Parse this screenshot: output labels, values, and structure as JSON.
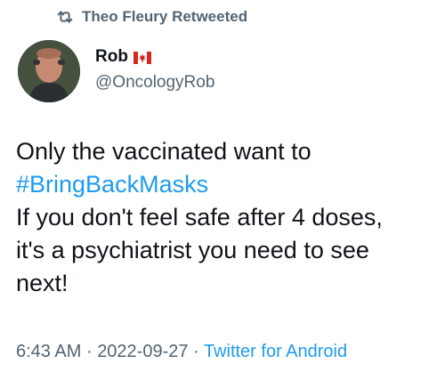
{
  "retweet": {
    "icon": "retweet-icon",
    "text": "Theo Fleury Retweeted"
  },
  "author": {
    "display_name": "Rob",
    "flag_icon": "canada-flag-icon",
    "handle": "@OncologyRob"
  },
  "tweet": {
    "lines": [
      "Only the vaccinated want to",
      "#BringBackMasks",
      "If you don't feel safe after 4 doses,",
      "it's a psychiatrist you need to see",
      "next!"
    ]
  },
  "meta": {
    "time": "6:43 AM",
    "separator": "·",
    "date": "2022-09-27",
    "source": "Twitter for Android"
  },
  "colors": {
    "text_primary": "#0f1419",
    "text_secondary": "#536471",
    "link": "#1d9bf0",
    "flag_red": "#d52b1e"
  }
}
